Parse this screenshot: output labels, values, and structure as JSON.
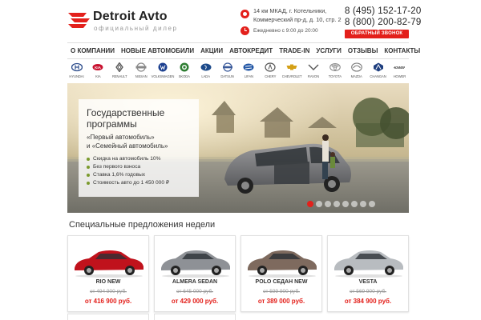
{
  "header": {
    "logo_title": "Detroit Avto",
    "logo_subtitle": "официальный дилер",
    "address_line1": "14 км МКАД, г. Котельники,",
    "address_line2": "Коммерческий пр-д, д. 10, стр. 2",
    "hours": "Ежедневно с 9:00 до 20:00",
    "phone1": "8 (495) 152-17-20",
    "phone2": "8 (800) 200-82-79",
    "callback_label": "ОБРАТНЫЙ ЗВОНОК",
    "accent_color": "#e3201b"
  },
  "nav": {
    "items": [
      "О КОМПАНИИ",
      "НОВЫЕ АВТОМОБИЛИ",
      "АКЦИИ",
      "АВТОКРЕДИТ",
      "TRADE-IN",
      "УСЛУГИ",
      "ОТЗЫВЫ",
      "КОНТАКТЫ"
    ]
  },
  "brands": [
    {
      "name": "HYUNDAI",
      "icon": "hyundai-logo-icon"
    },
    {
      "name": "KIA",
      "icon": "kia-logo-icon"
    },
    {
      "name": "RENAULT",
      "icon": "renault-logo-icon"
    },
    {
      "name": "NISSAN",
      "icon": "nissan-logo-icon"
    },
    {
      "name": "VOLKSWAGEN",
      "icon": "volkswagen-logo-icon"
    },
    {
      "name": "SKODA",
      "icon": "skoda-logo-icon"
    },
    {
      "name": "LADA",
      "icon": "lada-logo-icon"
    },
    {
      "name": "DATSUN",
      "icon": "datsun-logo-icon"
    },
    {
      "name": "LIFAN",
      "icon": "lifan-logo-icon"
    },
    {
      "name": "CHERY",
      "icon": "chery-logo-icon"
    },
    {
      "name": "CHEVROLET",
      "icon": "chevrolet-logo-icon"
    },
    {
      "name": "RAVON",
      "icon": "ravon-logo-icon"
    },
    {
      "name": "TOYOTA",
      "icon": "toyota-logo-icon"
    },
    {
      "name": "MAZDA",
      "icon": "mazda-logo-icon"
    },
    {
      "name": "CHANGAN",
      "icon": "changan-logo-icon"
    },
    {
      "name": "HOWER",
      "icon": "hower-logo-icon"
    }
  ],
  "hero": {
    "title_line1": "Государственные",
    "title_line2": "программы",
    "subtitle_line1": "«Первый автомобиль»",
    "subtitle_line2": "и «Семейный автомобиль»",
    "bullets": [
      "Скидка на автомобиль 10%",
      "Без первого взноса",
      "Ставка 1,6% годовых",
      "Стоимость авто до 1 450 000 ₽"
    ],
    "slide_count": 8,
    "active_slide": 1
  },
  "specials": {
    "title": "Специальные предложения недели",
    "cards": [
      {
        "name": "RIO NEW",
        "old_price": "от 494 900 руб.",
        "new_price": "от 416 900 руб.",
        "car_color": "#c0121c"
      },
      {
        "name": "ALMERA SEDAN",
        "old_price": "от 645 000 руб.",
        "new_price": "от 429 000 руб.",
        "car_color": "#8e9196"
      },
      {
        "name": "POLO СЕДАН NEW",
        "old_price": "от 599 900 руб.",
        "new_price": "от 389 000 руб.",
        "car_color": "#7e6a5e"
      },
      {
        "name": "VESTA",
        "old_price": "от 569 900 руб.",
        "new_price": "от 384 900 руб.",
        "car_color": "#b8bcc0"
      }
    ]
  }
}
